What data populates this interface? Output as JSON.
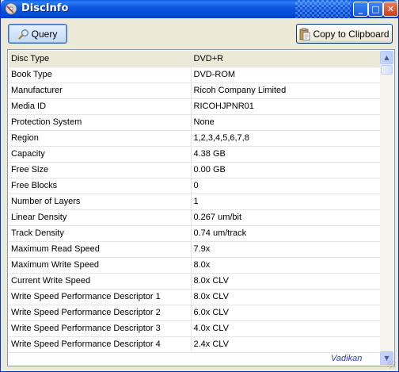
{
  "window": {
    "title": "DiscInfo",
    "minimize_glyph": "_",
    "maximize_glyph": "□",
    "close_glyph": "✕"
  },
  "toolbar": {
    "query_label": "Query",
    "copy_label": "Copy to Clipboard"
  },
  "table": {
    "rows": [
      {
        "property": "Disc Type",
        "value": "DVD+R"
      },
      {
        "property": "Book Type",
        "value": "DVD-ROM"
      },
      {
        "property": "Manufacturer",
        "value": "Ricoh Company Limited"
      },
      {
        "property": "Media ID",
        "value": "RICOHJPNR01"
      },
      {
        "property": "Protection System",
        "value": "None"
      },
      {
        "property": "Region",
        "value": "1,2,3,4,5,6,7,8"
      },
      {
        "property": "Capacity",
        "value": "4.38 GB"
      },
      {
        "property": "Free Size",
        "value": "0.00 GB"
      },
      {
        "property": "Free Blocks",
        "value": "0"
      },
      {
        "property": "Number of Layers",
        "value": "1"
      },
      {
        "property": "Linear Density",
        "value": "0.267 um/bit"
      },
      {
        "property": "Track Density",
        "value": "0.74 um/track"
      },
      {
        "property": "Maximum Read Speed",
        "value": "7.9x"
      },
      {
        "property": "Maximum Write Speed",
        "value": "8.0x"
      },
      {
        "property": "Current Write Speed",
        "value": "8.0x CLV"
      },
      {
        "property": "Write Speed Performance Descriptor 1",
        "value": "8.0x CLV"
      },
      {
        "property": "Write Speed Performance Descriptor 2",
        "value": "6.0x CLV"
      },
      {
        "property": "Write Speed Performance Descriptor 3",
        "value": "4.0x CLV"
      },
      {
        "property": "Write Speed Performance Descriptor 4",
        "value": "2.4x CLV"
      }
    ]
  },
  "scrollbar": {
    "up_glyph": "▲",
    "down_glyph": "▼"
  },
  "watermark": "Vadikan",
  "colors": {
    "titlebar": "#0a5fe8",
    "window_bg": "#ece9d8",
    "watermark": "#2a39c8"
  }
}
